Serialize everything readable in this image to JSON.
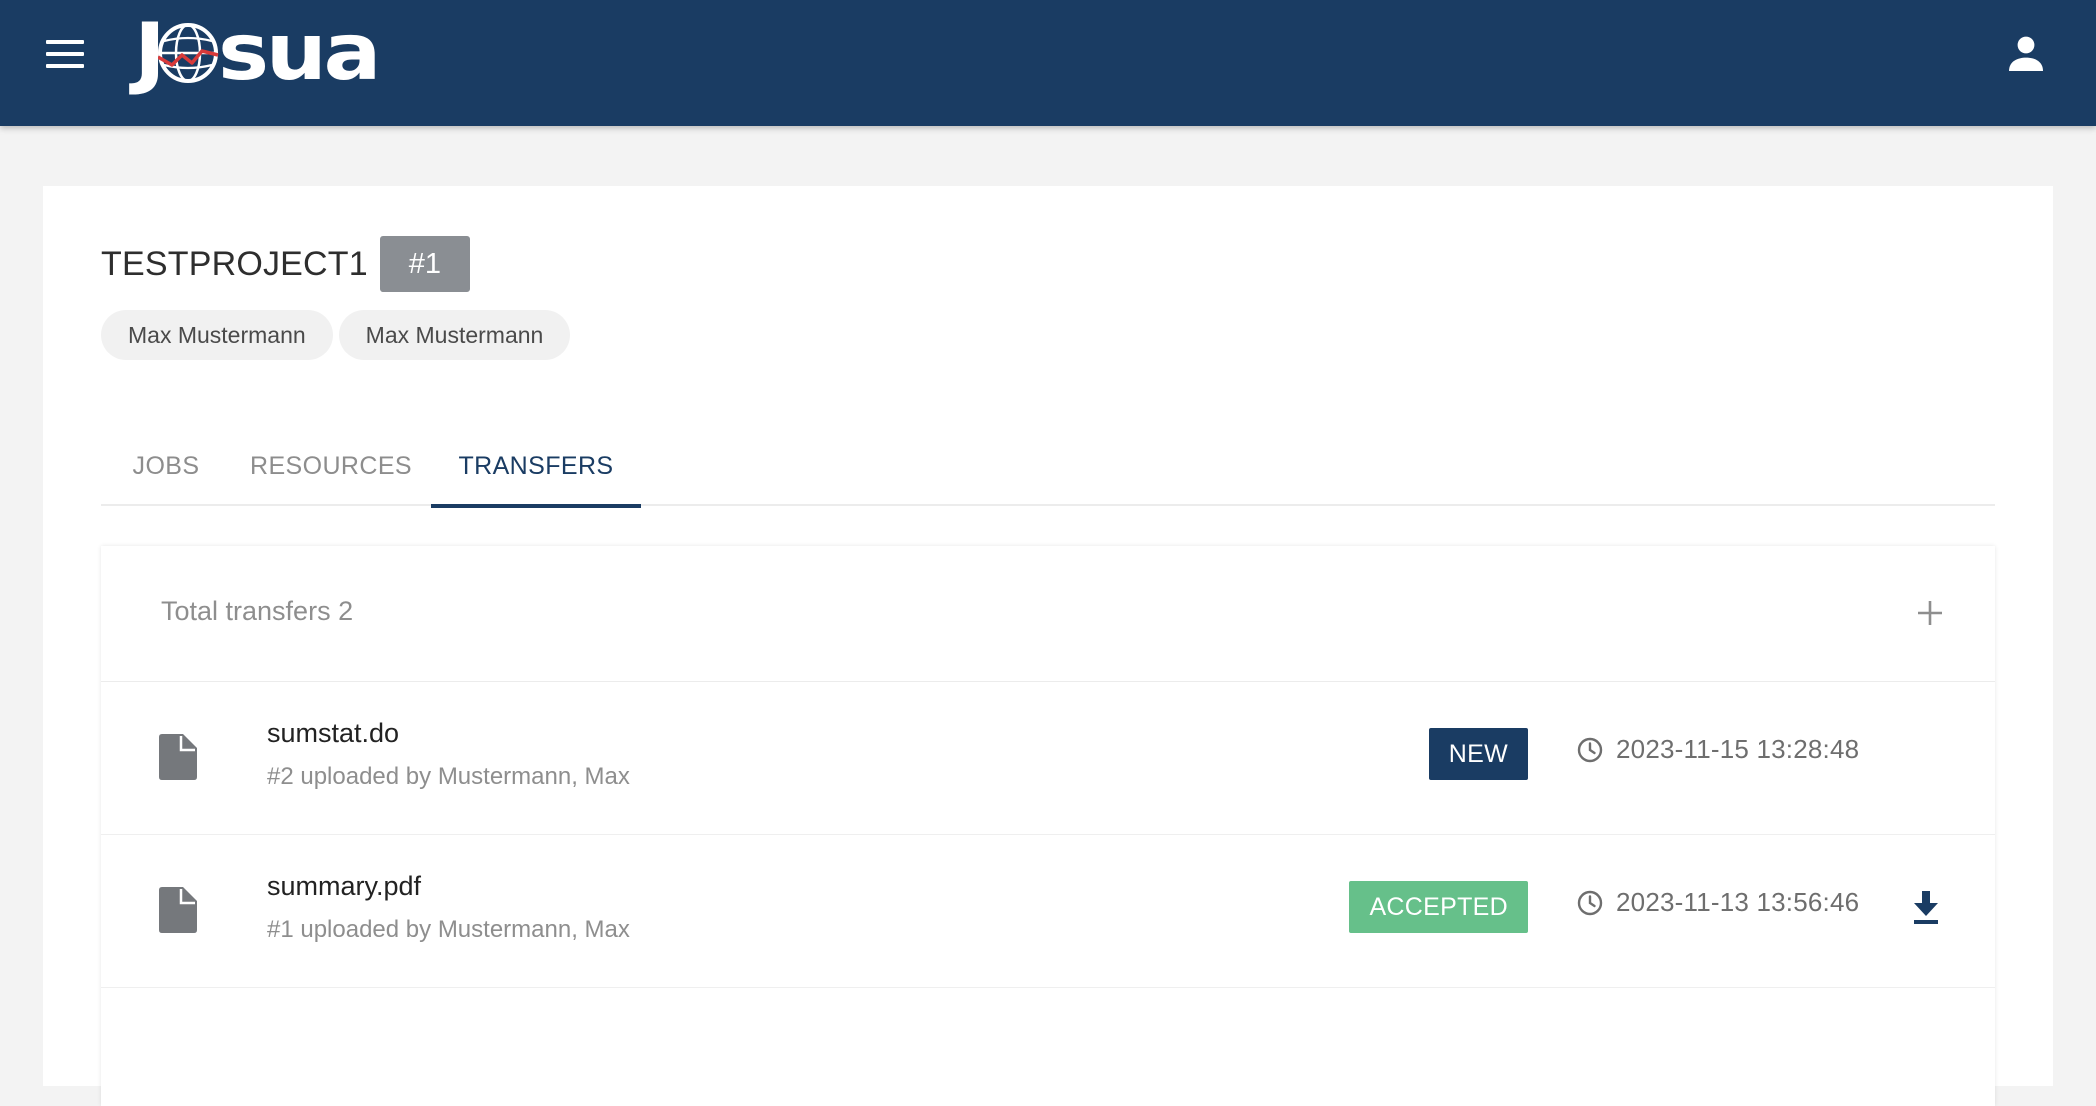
{
  "app": {
    "logo_text_start": "J",
    "logo_text_end": "sua",
    "brand_color": "#1a3c63"
  },
  "project": {
    "title": "TESTPROJECT1",
    "id_badge": "#1",
    "members": [
      "Max Mustermann",
      "Max Mustermann"
    ]
  },
  "tabs": [
    {
      "label": "JOBS",
      "active": false
    },
    {
      "label": "RESOURCES",
      "active": false
    },
    {
      "label": "TRANSFERS",
      "active": true
    }
  ],
  "transfers": {
    "total_label": "Total transfers 2",
    "items": [
      {
        "name": "sumstat.do",
        "meta": "#2 uploaded by Mustermann, Max",
        "status": "NEW",
        "status_color": "#1a3c63",
        "timestamp": "2023-11-15 13:28:48",
        "downloadable": false
      },
      {
        "name": "summary.pdf",
        "meta": "#1 uploaded by Mustermann, Max",
        "status": "ACCEPTED",
        "status_color": "#66c08a",
        "timestamp": "2023-11-13 13:56:46",
        "downloadable": true
      }
    ]
  },
  "icons": {
    "menu": "menu-icon",
    "account": "account-icon",
    "add": "plus-icon",
    "file": "file-icon",
    "clock": "clock-icon",
    "download": "download-icon"
  }
}
